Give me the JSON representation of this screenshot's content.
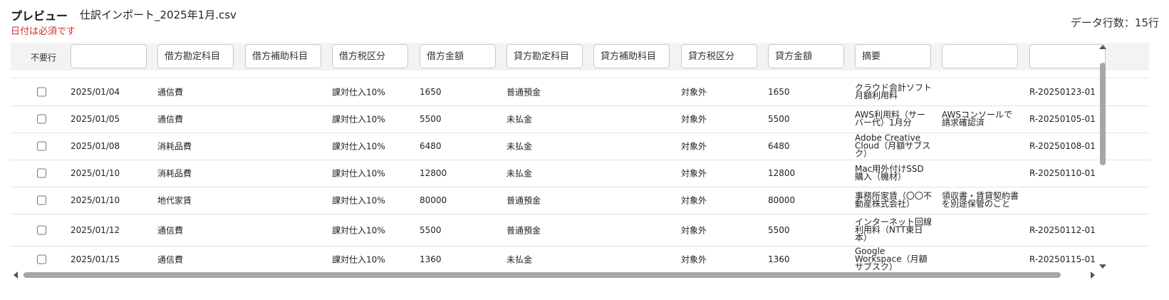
{
  "header": {
    "title": "プレビュー",
    "file_name": "仕訳インポート_2025年1月.csv",
    "error": "日付は必須です",
    "row_count": "データ行数：15行"
  },
  "columns": {
    "skip_label": "不要行",
    "mapping": [
      {
        "name": "date",
        "placeholder": ""
      },
      {
        "name": "debit-account",
        "placeholder": "借方勘定科目"
      },
      {
        "name": "debit-sub-account",
        "placeholder": "借方補助科目"
      },
      {
        "name": "debit-tax-category",
        "placeholder": "借方税区分"
      },
      {
        "name": "debit-amount",
        "placeholder": "借方金額"
      },
      {
        "name": "credit-account",
        "placeholder": "貸方勘定科目"
      },
      {
        "name": "credit-sub-account",
        "placeholder": "貸方補助科目"
      },
      {
        "name": "credit-tax-category",
        "placeholder": "貸方税区分"
      },
      {
        "name": "credit-amount",
        "placeholder": "貸方金額"
      },
      {
        "name": "description",
        "placeholder": "摘要"
      },
      {
        "name": "memo",
        "placeholder": ""
      },
      {
        "name": "reference",
        "placeholder": ""
      }
    ]
  },
  "rows": [
    {
      "date": "2025/01/04",
      "debit_account": "通信費",
      "debit_sub": "",
      "debit_tax": "課対仕入10%",
      "debit_amount": "1650",
      "credit_account": "普通預金",
      "credit_sub": "",
      "credit_tax": "対象外",
      "credit_amount": "1650",
      "description": "クラウド会計ソフト月額利用料",
      "memo": "",
      "reference": "R-20250123-01"
    },
    {
      "date": "2025/01/05",
      "debit_account": "通信費",
      "debit_sub": "",
      "debit_tax": "課対仕入10%",
      "debit_amount": "5500",
      "credit_account": "未払金",
      "credit_sub": "",
      "credit_tax": "対象外",
      "credit_amount": "5500",
      "description": "AWS利用料（サーバー代）1月分",
      "memo": "AWSコンソールで請求確認済",
      "reference": "R-20250105-01"
    },
    {
      "date": "2025/01/08",
      "debit_account": "消耗品費",
      "debit_sub": "",
      "debit_tax": "課対仕入10%",
      "debit_amount": "6480",
      "credit_account": "未払金",
      "credit_sub": "",
      "credit_tax": "対象外",
      "credit_amount": "6480",
      "description": "Adobe Creative Cloud（月額サブスク）",
      "memo": "",
      "reference": "R-20250108-01"
    },
    {
      "date": "2025/01/10",
      "debit_account": "消耗品費",
      "debit_sub": "",
      "debit_tax": "課対仕入10%",
      "debit_amount": "12800",
      "credit_account": "未払金",
      "credit_sub": "",
      "credit_tax": "対象外",
      "credit_amount": "12800",
      "description": "Mac用外付けSSD購入（機材）",
      "memo": "",
      "reference": "R-20250110-01"
    },
    {
      "date": "2025/01/10",
      "debit_account": "地代家賃",
      "debit_sub": "",
      "debit_tax": "課対仕入10%",
      "debit_amount": "80000",
      "credit_account": "普通預金",
      "credit_sub": "",
      "credit_tax": "対象外",
      "credit_amount": "80000",
      "description": "事務所家賃（〇〇不動産株式会社）",
      "memo": "領収書・賃貸契約書を別途保管のこと",
      "reference": ""
    },
    {
      "date": "2025/01/12",
      "debit_account": "通信費",
      "debit_sub": "",
      "debit_tax": "課対仕入10%",
      "debit_amount": "5500",
      "credit_account": "普通預金",
      "credit_sub": "",
      "credit_tax": "対象外",
      "credit_amount": "5500",
      "description": "インターネット回線利用料（NTT東日本）",
      "memo": "",
      "reference": "R-20250112-01"
    },
    {
      "date": "2025/01/15",
      "debit_account": "通信費",
      "debit_sub": "",
      "debit_tax": "課対仕入10%",
      "debit_amount": "1360",
      "credit_account": "未払金",
      "credit_sub": "",
      "credit_tax": "対象外",
      "credit_amount": "1360",
      "description": "Google Workspace（月額サブスク）",
      "memo": "",
      "reference": "R-20250115-01"
    }
  ]
}
